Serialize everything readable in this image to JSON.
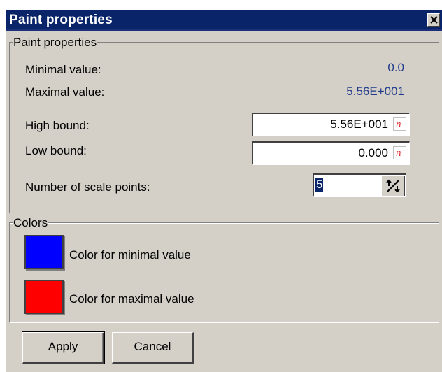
{
  "window": {
    "title": "Paint properties"
  },
  "paint_group": {
    "legend": "Paint properties",
    "minimal_label": "Minimal value:",
    "minimal_value": "0.0",
    "maximal_label": "Maximal value:",
    "maximal_value": "5.56E+001",
    "high_bound_label": "High bound:",
    "high_bound_value": "5.56E+001",
    "low_bound_label": "Low bound:",
    "low_bound_value": "0.000",
    "scale_points_label": "Number of scale points:",
    "scale_points_value": "5"
  },
  "colors_group": {
    "legend": "Colors",
    "min_color_label": "Color for minimal value",
    "min_color": "#0000ff",
    "max_color_label": "Color for maximal value",
    "max_color": "#ff0000"
  },
  "buttons": {
    "apply": "Apply",
    "cancel": "Cancel"
  },
  "icons": {
    "close": "close-icon",
    "numeric": "numeric-format-icon",
    "spinner": "spinner-arrows-icon"
  }
}
